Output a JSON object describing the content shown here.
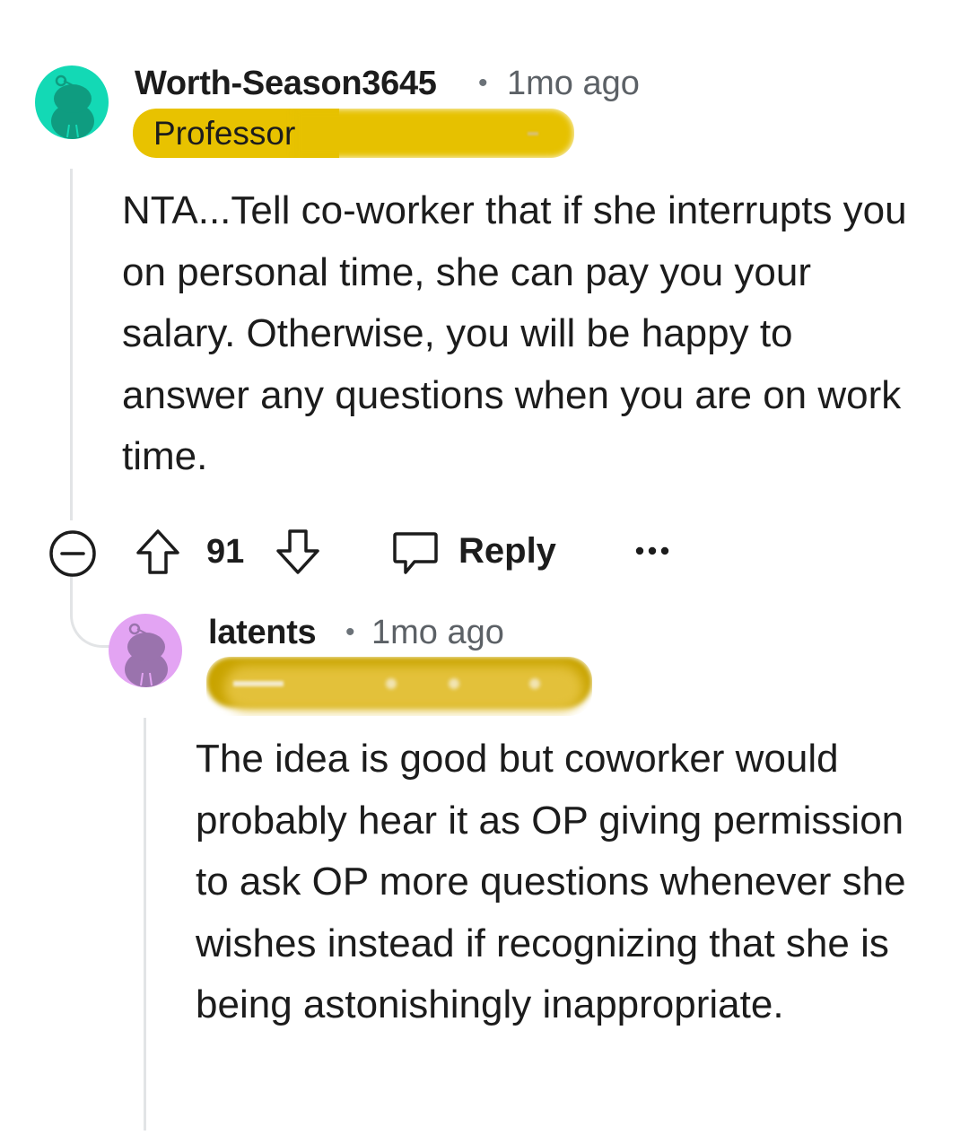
{
  "comments": [
    {
      "username": "Worth-Season3645",
      "separator": "•",
      "timestamp": "1mo ago",
      "flair_text": "Professor",
      "flair_color": "#e8c200",
      "avatar_color": "#13d9b5",
      "avatar_figure_color": "#0f9c80",
      "avatar_icon": "snoo-avatar-icon",
      "body": "NTA...Tell co-worker that if she interrupts you on personal time, she can pay you your salary. Otherwise, you will be happy to answer any questions when you are on work time.",
      "actions": {
        "collapse_icon": "collapse-minus-icon",
        "upvote_icon": "upvote-arrow-icon",
        "vote_count": "91",
        "downvote_icon": "downvote-arrow-icon",
        "reply_icon": "speech-bubble-icon",
        "reply_label": "Reply",
        "more_icon": "more-options-icon",
        "more_label": "•••"
      }
    },
    {
      "username": "latents",
      "separator": "•",
      "timestamp": "1mo ago",
      "flair_color": "#c9a400",
      "avatar_color": "#e3a4f3",
      "avatar_figure_color": "#9a73ad",
      "avatar_icon": "snoo-avatar-icon",
      "body": "The idea is good but coworker would probably hear it as OP giving permission to ask OP more questions whenever she wishes instead if recognizing that she is being astonishingly inappropriate."
    }
  ]
}
